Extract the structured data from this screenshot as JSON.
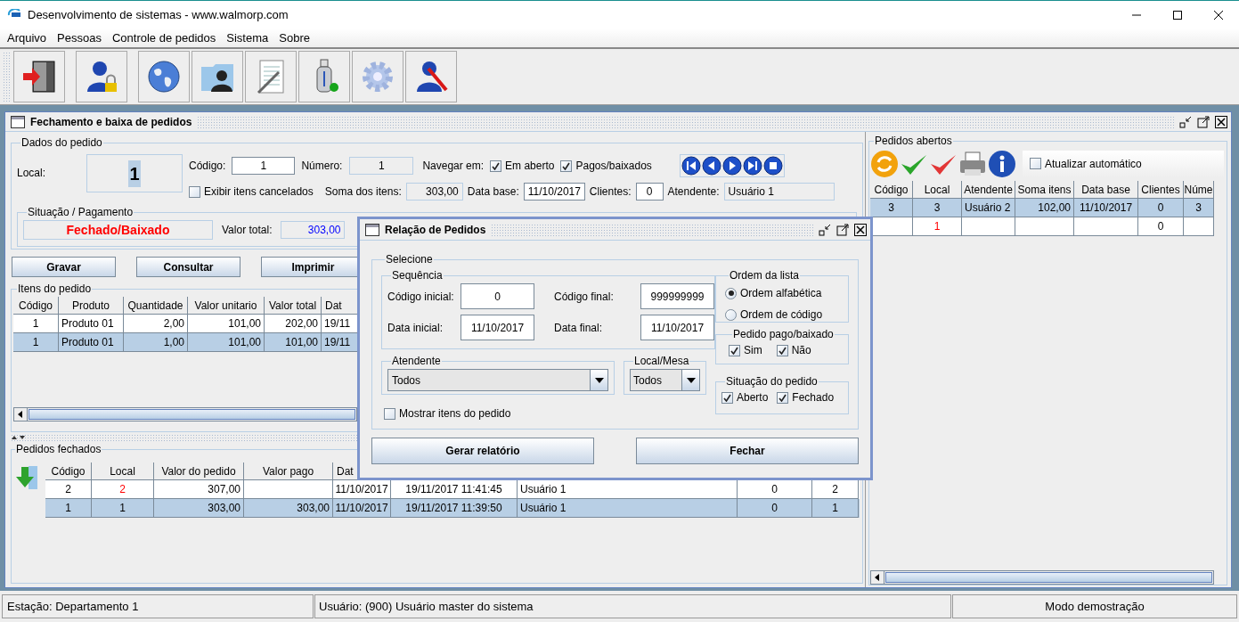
{
  "window": {
    "title": "Desenvolvimento de sistemas - www.walmorp.com"
  },
  "menu": [
    "Arquivo",
    "Pessoas",
    "Controle de pedidos",
    "Sistema",
    "Sobre"
  ],
  "frame": {
    "title": "Fechamento e baixa de pedidos"
  },
  "dados": {
    "legend": "Dados do pedido",
    "local_label": "Local:",
    "local_value": "1",
    "codigo_label": "Código:",
    "codigo_value": "1",
    "numero_label": "Número:",
    "numero_value": "1",
    "navegar_label": "Navegar em:",
    "navegar": [
      {
        "label": "Em aberto",
        "checked": true
      },
      {
        "label": "Pagos/baixados",
        "checked": true
      }
    ],
    "exibir": {
      "label": "Exibir itens cancelados",
      "checked": false
    },
    "soma_label": "Soma dos itens:",
    "soma_value": "303,00",
    "data_base_label": "Data base:",
    "data_base_value": "11/10/2017",
    "clientes_label": "Clientes:",
    "clientes_value": "0",
    "atendente_label": "Atendente:",
    "atendente_value": "Usuário 1",
    "situacao": {
      "legend": "Situação / Pagamento",
      "status": "Fechado/Baixado",
      "valor_label": "Valor total:",
      "valor_value": "303,00"
    }
  },
  "buttons": [
    "Gravar",
    "Consultar",
    "Imprimir"
  ],
  "itens": {
    "legend": "Itens do pedido",
    "columns": [
      "Código",
      "Produto",
      "Quantidade",
      "Valor unitario",
      "Valor total",
      "Dat"
    ],
    "rows": [
      {
        "selected": false,
        "cells": [
          "1",
          "Produto 01",
          "2,00",
          "101,00",
          "202,00",
          "19/11"
        ]
      },
      {
        "selected": true,
        "cells": [
          "1",
          "Produto 01",
          "1,00",
          "101,00",
          "101,00",
          "19/11"
        ]
      }
    ]
  },
  "fechados": {
    "legend": "Pedidos fechados",
    "columns": [
      "Código",
      "Local",
      "Valor do pedido",
      "Valor pago",
      "Dat"
    ],
    "rows": [
      {
        "selected": false,
        "local_flagged": true,
        "cells": [
          "2",
          "2",
          "307,00",
          null,
          "11/10/2017",
          "19/11/2017 11:41:45",
          "Usuário 1",
          "0",
          "2"
        ]
      },
      {
        "selected": true,
        "local_flagged": false,
        "cells": [
          "1",
          "1",
          "303,00",
          "303,00",
          "11/10/2017",
          "19/11/2017 11:39:50",
          "Usuário 1",
          "0",
          "1"
        ]
      }
    ]
  },
  "abertos": {
    "legend": "Pedidos abertos",
    "auto": {
      "label": "Atualizar automático",
      "checked": false
    },
    "columns": [
      "Código",
      "Local",
      "Atendente",
      "Soma itens",
      "Data base",
      "Clientes",
      "Núme"
    ],
    "rows": [
      {
        "selected": true,
        "local_flagged": false,
        "cells": [
          "3",
          "3",
          "Usuário 2",
          "102,00",
          "11/10/2017",
          "0",
          "3"
        ]
      },
      {
        "selected": false,
        "local_flagged": true,
        "cells": [
          null,
          "1",
          null,
          null,
          null,
          "0",
          null
        ]
      }
    ]
  },
  "dialog": {
    "title": "Relação de Pedidos",
    "selecione": "Selecione",
    "sequencia": "Sequência",
    "codigo_inicial_label": "Código inicial:",
    "codigo_inicial": "0",
    "codigo_final_label": "Código final:",
    "codigo_final": "999999999",
    "data_inicial_label": "Data inicial:",
    "data_inicial": "11/10/2017",
    "data_final_label": "Data final:",
    "data_final": "11/10/2017",
    "atendente_legend": "Atendente",
    "atendente_value": "Todos",
    "local_legend": "Local/Mesa",
    "local_value": "Todos",
    "mostrar": {
      "label": "Mostrar itens do pedido",
      "checked": false
    },
    "ordem_legend": "Ordem da lista",
    "ordem": [
      {
        "label": "Ordem alfabética",
        "selected": true
      },
      {
        "label": "Ordem de código",
        "selected": false
      }
    ],
    "pago_legend": "Pedido pago/baixado",
    "pago": [
      {
        "label": "Sim",
        "checked": true
      },
      {
        "label": "Não",
        "checked": true
      }
    ],
    "situacao_legend": "Situação do pedido",
    "situacao": [
      {
        "label": "Aberto",
        "checked": true
      },
      {
        "label": "Fechado",
        "checked": true
      }
    ],
    "buttons": [
      "Gerar relatório",
      "Fechar"
    ]
  },
  "status_bar": [
    "Estação: Departamento 1",
    "Usuário: (900) Usuário master do sistema",
    "Modo demostração"
  ]
}
